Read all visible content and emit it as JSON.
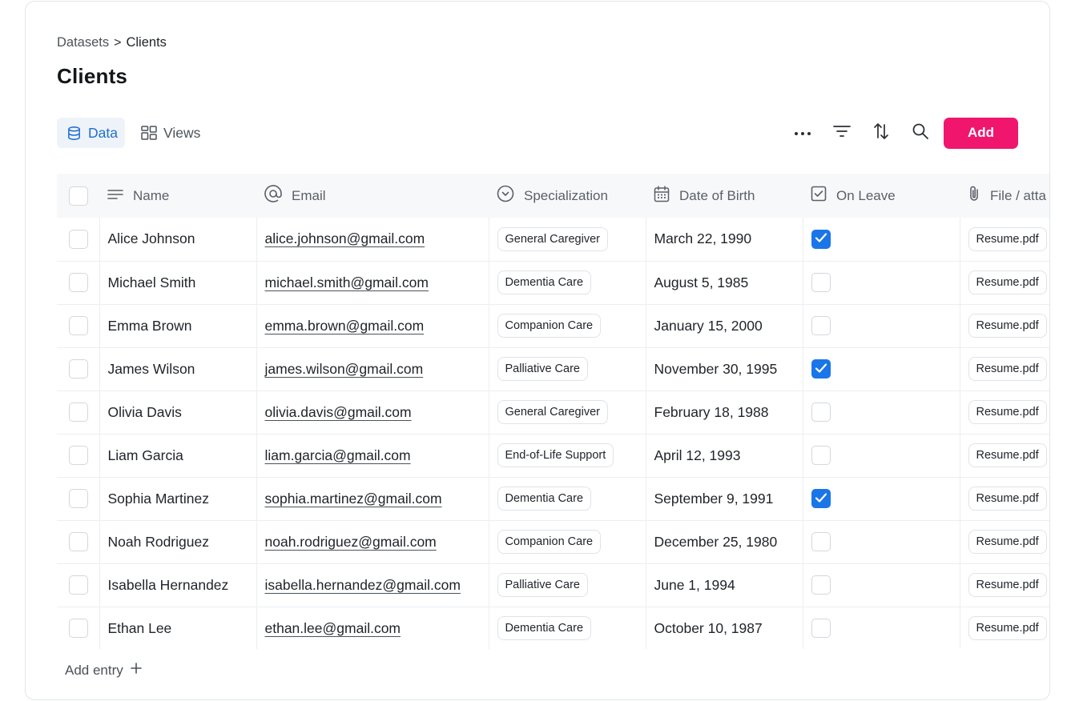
{
  "breadcrumb": {
    "parent": "Datasets",
    "separator": ">",
    "current": "Clients"
  },
  "page": {
    "title": "Clients"
  },
  "tabs": [
    {
      "label": "Data",
      "icon": "database-icon",
      "active": true
    },
    {
      "label": "Views",
      "icon": "layout-grid-icon",
      "active": false
    }
  ],
  "toolbar": {
    "icons": [
      "more-icon",
      "filter-icon",
      "sort-icon",
      "search-icon"
    ],
    "add_label": "Add",
    "accent_color": "#f0166e"
  },
  "table": {
    "columns": [
      {
        "label": "Name",
        "icon": "text-icon"
      },
      {
        "label": "Email",
        "icon": "at-icon"
      },
      {
        "label": "Specialization",
        "icon": "select-icon"
      },
      {
        "label": "Date of Birth",
        "icon": "calendar-icon"
      },
      {
        "label": "On Leave",
        "icon": "checkbox-icon"
      },
      {
        "label": "File / atta",
        "icon": "paperclip-icon"
      }
    ],
    "rows": [
      {
        "name": "Alice Johnson",
        "email": "alice.johnson@gmail.com",
        "specialization": "General Caregiver",
        "dob": "March 22, 1990",
        "on_leave": true,
        "file": "Resume.pdf"
      },
      {
        "name": "Michael Smith",
        "email": "michael.smith@gmail.com",
        "specialization": "Dementia Care",
        "dob": "August 5, 1985",
        "on_leave": false,
        "file": "Resume.pdf"
      },
      {
        "name": "Emma Brown",
        "email": "emma.brown@gmail.com",
        "specialization": "Companion Care",
        "dob": "January 15, 2000",
        "on_leave": false,
        "file": "Resume.pdf"
      },
      {
        "name": "James Wilson",
        "email": "james.wilson@gmail.com",
        "specialization": "Palliative Care",
        "dob": "November 30, 1995",
        "on_leave": true,
        "file": "Resume.pdf"
      },
      {
        "name": "Olivia Davis",
        "email": "olivia.davis@gmail.com",
        "specialization": "General Caregiver",
        "dob": "February 18, 1988",
        "on_leave": false,
        "file": "Resume.pdf"
      },
      {
        "name": "Liam Garcia",
        "email": "liam.garcia@gmail.com",
        "specialization": "End-of-Life Support",
        "dob": "April 12, 1993",
        "on_leave": false,
        "file": "Resume.pdf"
      },
      {
        "name": "Sophia Martinez",
        "email": "sophia.martinez@gmail.com",
        "specialization": "Dementia Care",
        "dob": "September 9, 1991",
        "on_leave": true,
        "file": "Resume.pdf"
      },
      {
        "name": "Noah Rodriguez",
        "email": "noah.rodriguez@gmail.com",
        "specialization": "Companion Care",
        "dob": "December 25, 1980",
        "on_leave": false,
        "file": "Resume.pdf"
      },
      {
        "name": "Isabella Hernandez",
        "email": "isabella.hernandez@gmail.com",
        "specialization": "Palliative Care",
        "dob": "June 1, 1994",
        "on_leave": false,
        "file": "Resume.pdf"
      },
      {
        "name": "Ethan Lee",
        "email": "ethan.lee@gmail.com",
        "specialization": "Dementia Care",
        "dob": "October 10, 1987",
        "on_leave": false,
        "file": "Resume.pdf"
      }
    ]
  },
  "footer": {
    "add_entry_label": "Add entry",
    "add_entry_icon": "plus-icon"
  },
  "colors": {
    "checkbox_checked": "#1a76e8",
    "active_tab": "#1f6fd1"
  }
}
